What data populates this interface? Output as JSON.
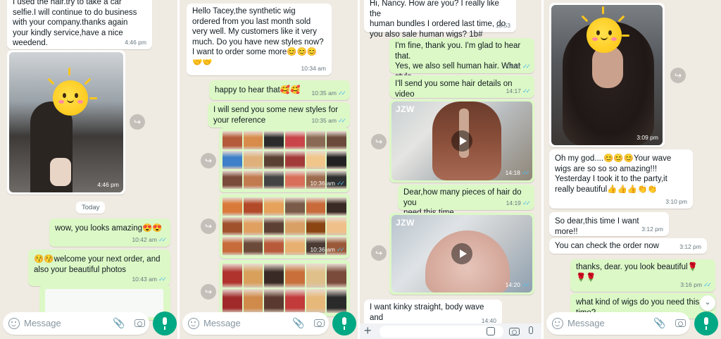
{
  "input_placeholder": "Message",
  "colors": {
    "chat_bg": "#efeae2",
    "incoming": "#ffffff",
    "outgoing": "#dcf8c6",
    "accent": "#00a884",
    "read_ticks": "#53bdeb"
  },
  "icons": [
    "emoji-icon",
    "attach-icon",
    "camera-icon",
    "mic-icon",
    "forward-icon",
    "play-icon",
    "plus-icon",
    "sticker-icon",
    "scroll-down-icon"
  ],
  "panel1": {
    "msg_top": {
      "text": "I used the hair.try to take a car\nselfie.I will continue to do business\nwith your company.thanks again\nyour kindly service,have a nice\nweedend.",
      "time": "4:46 pm"
    },
    "photo": {
      "time": "4:46 pm"
    },
    "date_separator": "Today",
    "msg_amazing": {
      "text": "wow, you looks amazing😍😍",
      "time": "10:42 am"
    },
    "msg_welcome": {
      "text": "😚😚welcome your next order, and\nalso your beautiful photos",
      "time": "10:43 am"
    }
  },
  "panel2": {
    "msg_hello": {
      "text": "Hello Tacey,the synthetic wig\nordered from you last month sold\nvery well. My customers like it very\nmuch. Do you have new styles now?\nI want to order some more😊😊😊\n🤝🤝",
      "time": "10:34 am"
    },
    "msg_happy": {
      "text": "happy to hear that🥰🥰",
      "time": "10:35 am"
    },
    "msg_styles": {
      "text": "I will send you some new styles for\nyour reference",
      "time": "10:35 am"
    },
    "catalog_1": {
      "time": "10:36 am"
    },
    "catalog_2": {
      "time": "10:36 am"
    }
  },
  "panel3": {
    "msg_hi": {
      "text": "Hi, Nancy. How are you?  I really like the\nhuman bundles I ordered last time, do\nyou also sale human wigs? 1b#",
      "time": "13:53"
    },
    "msg_fine": {
      "text": "I'm fine, thank you. I'm glad to hear that.\nYes, we also sell human hair. What style\ndo you need",
      "time": "14:17"
    },
    "msg_video_details": {
      "text": "I'll send you some hair details on video",
      "time": "14:17"
    },
    "video_1": {
      "label": "JZW",
      "time": "14:18"
    },
    "msg_pieces": {
      "text": "Dear,how many pieces of hair do you\nneed this time",
      "time": "14:19"
    },
    "video_2": {
      "label": "JZW",
      "time": "14:20"
    },
    "msg_kinky": {
      "text": "I want kinky straight, body wave and\ndeep wave",
      "time": "14:40"
    }
  },
  "panel4": {
    "photo": {
      "time": "3:09 pm"
    },
    "msg_ohmygod": {
      "text": "Oh my god....😊😊😊Your wave\nwigs are so so so amazing!!!\nYesterday I took it to the party,it\nreally beautiful👍👍👍👏👏",
      "time": "3:10 pm"
    },
    "msg_more": {
      "text": "So dear,this time I want more!!",
      "time": "3:12 pm"
    },
    "msg_check": {
      "text": "You can check the order now",
      "time": "3:12 pm"
    },
    "msg_thanks": {
      "text": "thanks, dear. you look beautiful🌹\n🌹🌹",
      "time": "3:16 pm"
    },
    "msg_what_kind": {
      "text": "what kind of wigs do you need this\ntime?"
    }
  }
}
